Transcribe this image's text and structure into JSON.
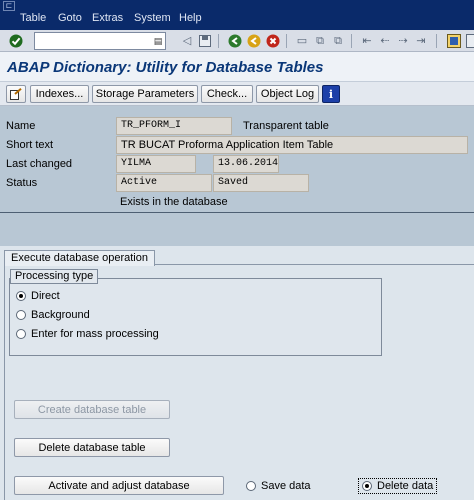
{
  "menu": {
    "system_icon": "⊏",
    "items": [
      "Table",
      "Goto",
      "Extras",
      "System",
      "Help"
    ]
  },
  "toolbar": {
    "command_value": "",
    "icons": [
      "check-icon",
      "back-icon",
      "save-icon",
      "green-arrow-icon",
      "exit-icon",
      "cancel-icon",
      "print-icon",
      "find-icon",
      "find-next-icon",
      "first-page-icon",
      "prev-page-icon",
      "next-page-icon",
      "last-page-icon",
      "layout-icon"
    ]
  },
  "title": "ABAP Dictionary: Utility for Database Tables",
  "app_toolbar": {
    "indexes": "Indexes...",
    "storage": "Storage Parameters",
    "check": "Check...",
    "log": "Object Log",
    "info_icon": "i"
  },
  "header": {
    "name_label": "Name",
    "name_value": "TR_PFORM_I",
    "table_type": "Transparent table",
    "short_text_label": "Short text",
    "short_text_value": "TR BUCAT Proforma Application Item Table",
    "last_changed_label": "Last changed",
    "changed_by": "YILMA",
    "changed_on": "13.06.2014",
    "status_label": "Status",
    "status_value": "Active",
    "status_saved": "Saved",
    "db_note": "Exists in the database"
  },
  "execute": {
    "tab_label": "Execute database operation",
    "processing_type": "Processing type",
    "options": [
      "Direct",
      "Background",
      "Enter for mass processing"
    ],
    "selected_option": "Direct",
    "create_btn": "Create database table",
    "delete_btn": "Delete database table",
    "activate_btn": "Activate and adjust database",
    "save_data": "Save data",
    "delete_data": "Delete data",
    "selected_data_option": "Delete data"
  }
}
